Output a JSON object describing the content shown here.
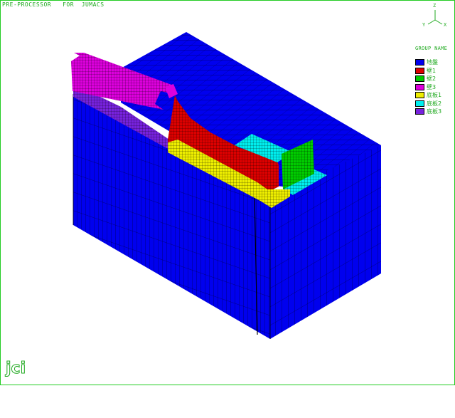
{
  "window": {
    "title": "PRE-PROCESSOR   FOR  JUMACS"
  },
  "axis": {
    "icon": "xyz-axis-icon",
    "z_label": "Z",
    "y_label": "Y",
    "x_label": "X"
  },
  "legend": {
    "title": "GROUP NAME",
    "items": [
      {
        "label": "地盤",
        "color": "#0000ee"
      },
      {
        "label": "壁1",
        "color": "#dd0000"
      },
      {
        "label": "壁2",
        "color": "#00cc00"
      },
      {
        "label": "壁3",
        "color": "#dd00dd"
      },
      {
        "label": "底板1",
        "color": "#eeee00"
      },
      {
        "label": "底板2",
        "color": "#00eeee"
      },
      {
        "label": "底板3",
        "color": "#7722dd"
      }
    ]
  },
  "logo": {
    "icon": "jci-logo-icon",
    "text": "jci"
  },
  "colors": {
    "ui_green": "#22cc22",
    "mesh_line": "#000000",
    "ground": "#0000ee"
  }
}
